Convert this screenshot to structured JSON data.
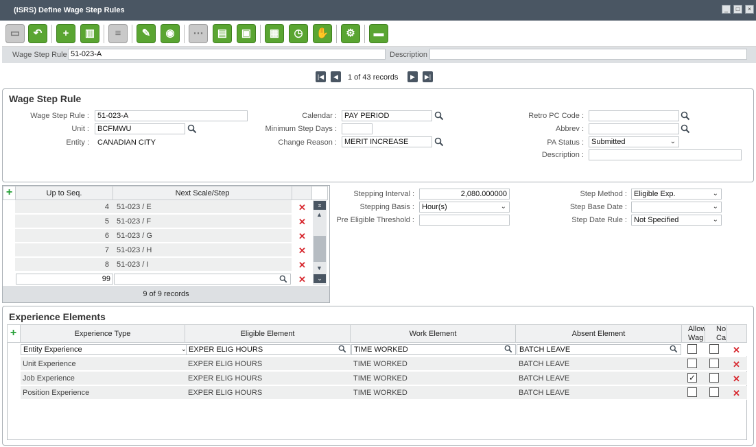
{
  "window": {
    "title": "(ISRS) Define Wage Step Rules",
    "min": "_",
    "max": "□",
    "close": "×"
  },
  "toolbar": {
    "buttons": [
      "save-icon",
      "undo-icon",
      "add-icon",
      "delete-icon",
      "notes-icon",
      "edit-icon",
      "view-icon",
      "workflow-icon",
      "clipboard-icon",
      "export-icon",
      "report-icon",
      "calendar-icon",
      "handshake-icon",
      "settings-icon",
      "screen-icon"
    ]
  },
  "header": {
    "rule_label": "Wage Step Rule",
    "rule_value": "51-023-A",
    "desc_label": "Description",
    "desc_value": ""
  },
  "pager": {
    "text": "1 of 43 records",
    "first": "|◀",
    "prev": "◀",
    "next": "▶",
    "last": "▶|"
  },
  "wsr": {
    "title": "Wage Step Rule",
    "rule_label": "Wage Step Rule :",
    "rule_value": "51-023-A",
    "unit_label": "Unit :",
    "unit_value": "BCFMWU",
    "entity_label": "Entity :",
    "entity_value": "CANADIAN CITY",
    "calendar_label": "Calendar :",
    "calendar_value": "PAY PERIOD",
    "minstep_label": "Minimum Step Days :",
    "minstep_value": "",
    "change_label": "Change Reason :",
    "change_value": "MERIT INCREASE",
    "retro_label": "Retro PC Code :",
    "retro_value": "",
    "abbrev_label": "Abbrev :",
    "abbrev_value": "",
    "pastatus_label": "PA Status :",
    "pastatus_value": "Submitted",
    "desc_label": "Description :",
    "desc_value": ""
  },
  "steps": {
    "col_seq": "Up to Seq.",
    "col_next": "Next Scale/Step",
    "rows": [
      {
        "seq": "4",
        "next": "51-023  /  E"
      },
      {
        "seq": "5",
        "next": "51-023  /  F"
      },
      {
        "seq": "6",
        "next": "51-023  /  G"
      },
      {
        "seq": "7",
        "next": "51-023  /  H"
      },
      {
        "seq": "8",
        "next": "51-023  /  I"
      },
      {
        "seq": "99",
        "next": ""
      }
    ],
    "count": "9 of 9 records"
  },
  "stepping": {
    "interval_label": "Stepping Interval :",
    "interval_value": "2,080.000000",
    "basis_label": "Stepping Basis :",
    "basis_value": "Hour(s)",
    "pre_label": "Pre Eligible Threshold :",
    "pre_value": "",
    "method_label": "Step Method :",
    "method_value": "Eligible Exp.",
    "base_label": "Step Base Date :",
    "base_value": "",
    "rule_label": "Step Date Rule :",
    "rule_value": "Not Specified"
  },
  "experience": {
    "title": "Experience Elements",
    "cols": [
      "Experience Type",
      "Eligible Element",
      "Work Element",
      "Absent Element",
      "Allow Wag",
      "No Carr"
    ],
    "rows": [
      {
        "type": "Entity Experience",
        "elig": "EXPER ELIG HOURS",
        "work": "TIME WORKED",
        "absent": "BATCH LEAVE",
        "allow": false,
        "nocarry": false
      },
      {
        "type": "Unit Experience",
        "elig": "EXPER ELIG HOURS",
        "work": "TIME WORKED",
        "absent": "BATCH LEAVE",
        "allow": false,
        "nocarry": false
      },
      {
        "type": "Job Experience",
        "elig": "EXPER ELIG HOURS",
        "work": "TIME WORKED",
        "absent": "BATCH LEAVE",
        "allow": true,
        "nocarry": false
      },
      {
        "type": "Position Experience",
        "elig": "EXPER ELIG HOURS",
        "work": "TIME WORKED",
        "absent": "BATCH LEAVE",
        "allow": false,
        "nocarry": false
      }
    ]
  },
  "glyphs": {
    "x": "✕",
    "plus": "+",
    "check": "✓",
    "chev": "⌄"
  }
}
